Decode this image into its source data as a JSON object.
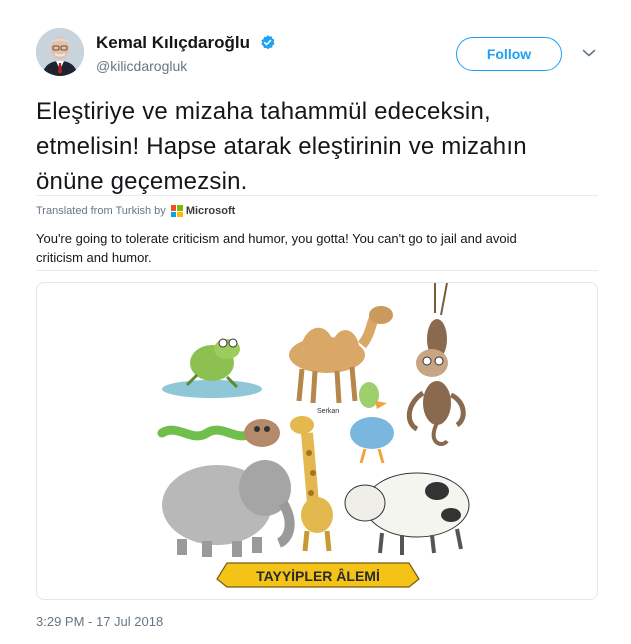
{
  "author": {
    "name": "Kemal Kılıçdaroğlu",
    "handle": "@kilicdarogluk",
    "verified": true
  },
  "actions": {
    "follow_label": "Follow",
    "more_icon": "chevron-down-icon"
  },
  "tweet": {
    "text_line1": "Eleştiriye ve mizaha tahammül edeceksin,",
    "text_line2": "etmelisin! Hapse atarak eleştirinin ve mizahın",
    "text_line3": "önüne geçemezsin.",
    "translated_from": "Translated from Turkish by",
    "translator_name": "Microsoft",
    "translation_line1": "You're going to tolerate criticism and humor, you gotta! You can't go to jail and avoid",
    "translation_line2": "criticism and humor.",
    "timestamp": "3:29 PM - 17 Jul 2018"
  },
  "media": {
    "banner_text": "TAYYİPLER ÂLEMİ",
    "caption_serkan": "Serkan"
  },
  "colors": {
    "accent": "#1da1f2",
    "text_primary": "#14171a",
    "text_secondary": "#657786",
    "border": "#e1e8ed",
    "banner_yellow": "#f3c318"
  }
}
